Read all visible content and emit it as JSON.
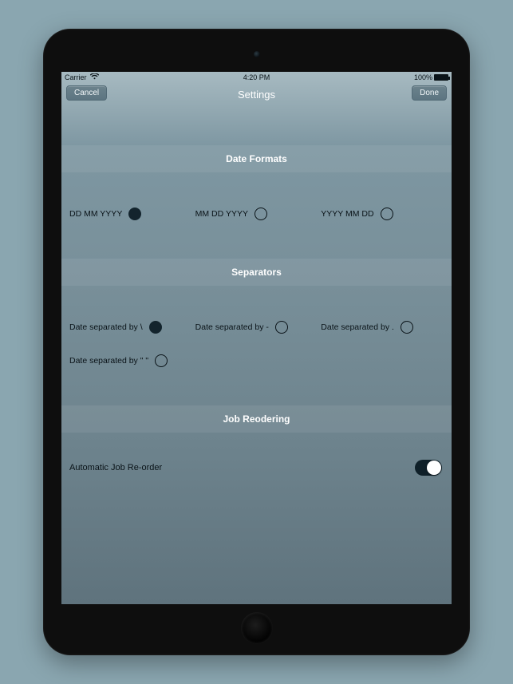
{
  "status": {
    "carrier": "Carrier",
    "time": "4:20 PM",
    "battery": "100%"
  },
  "nav": {
    "title": "Settings",
    "cancel_label": "Cancel",
    "done_label": "Done"
  },
  "sections": {
    "date_formats": {
      "header": "Date Formats",
      "options": [
        {
          "label": "DD MM YYYY",
          "selected": true
        },
        {
          "label": "MM DD YYYY",
          "selected": false
        },
        {
          "label": "YYYY MM DD",
          "selected": false
        }
      ]
    },
    "separators": {
      "header": "Separators",
      "options": [
        {
          "label": "Date separated by \\",
          "selected": true
        },
        {
          "label": "Date separated by -",
          "selected": false
        },
        {
          "label": "Date separated by .",
          "selected": false
        },
        {
          "label": "Date separated by \" \"",
          "selected": false
        }
      ]
    },
    "job_reordering": {
      "header": "Job Reodering",
      "toggle_label": "Automatic Job Re-order",
      "toggle_on": true
    }
  }
}
